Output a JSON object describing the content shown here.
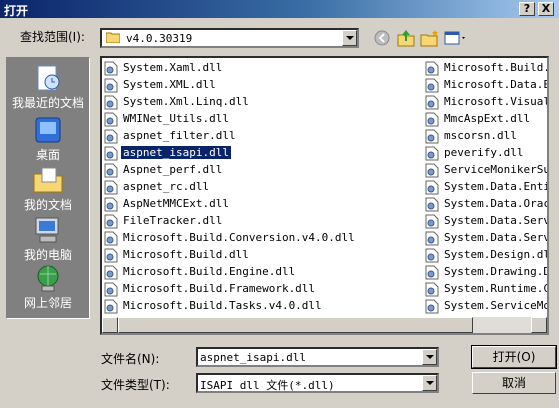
{
  "window": {
    "title": "打开",
    "help_button": "?",
    "close_button": "X"
  },
  "lookin": {
    "label": "查找范围(I):",
    "value": "v4.0.30319"
  },
  "places": [
    {
      "label": "我最近的文档",
      "icon": "recent-documents-icon"
    },
    {
      "label": "桌面",
      "icon": "desktop-icon"
    },
    {
      "label": "我的文档",
      "icon": "my-documents-icon"
    },
    {
      "label": "我的电脑",
      "icon": "my-computer-icon"
    },
    {
      "label": "网上邻居",
      "icon": "network-places-icon"
    }
  ],
  "files": {
    "column1": [
      "System.Xaml.dll",
      "System.XML.dll",
      "System.Xml.Linq.dll",
      "WMINet_Utils.dll",
      "aspnet_filter.dll",
      "aspnet_isapi.dll",
      "Aspnet_perf.dll",
      "aspnet_rc.dll",
      "AspNetMMCExt.dll",
      "FileTracker.dll",
      "Microsoft.Build.Conversion.v4.0.dll",
      "Microsoft.Build.dll",
      "Microsoft.Build.Engine.dll",
      "Microsoft.Build.Framework.dll",
      "Microsoft.Build.Tasks.v4.0.dll"
    ],
    "column2": [
      "Microsoft.Build.Ut",
      "Microsoft.Data.Ent",
      "Microsoft.VisualC.",
      "MmcAspExt.dll",
      "mscorsn.dll",
      "peverify.dll",
      "ServiceMonikerSupp",
      "System.Data.Entity",
      "System.Data.Oracle",
      "System.Data.Servic",
      "System.Data.Servic",
      "System.Design.dll",
      "System.Drawing.Des",
      "System.Runtime.Cac",
      "System.ServiceMode"
    ],
    "selected": "aspnet_isapi.dll"
  },
  "filename": {
    "label": "文件名(N):",
    "value": "aspnet_isapi.dll"
  },
  "filetype": {
    "label": "文件类型(T):",
    "value": "ISAPI dll 文件(*.dll)"
  },
  "buttons": {
    "open": "打开(O)",
    "cancel": "取消"
  },
  "colors": {
    "title_start": "#0a246a",
    "title_end": "#a6caf0",
    "selection": "#0a246a",
    "face": "#d4d0c8"
  }
}
